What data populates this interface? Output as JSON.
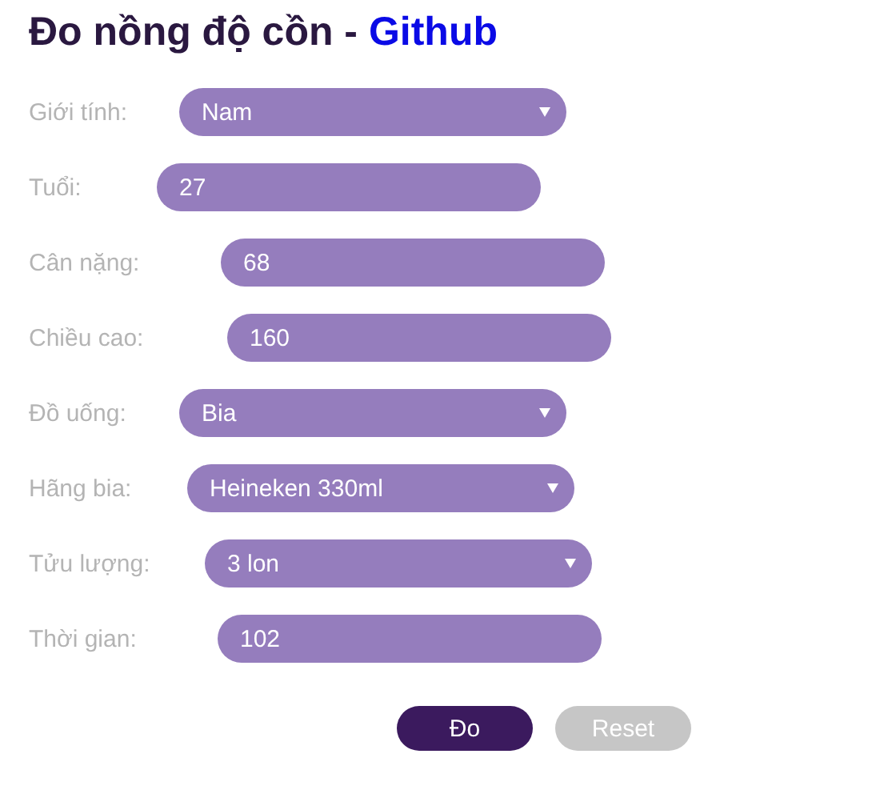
{
  "title": {
    "text": "Đo nồng độ cồn - ",
    "link": "Github"
  },
  "fields": [
    {
      "label": "Giới tính:",
      "kind": "select",
      "value": "Nam"
    },
    {
      "label": "Tuổi:",
      "kind": "input",
      "value": "27"
    },
    {
      "label": "Cân nặng:",
      "kind": "input",
      "value": "68"
    },
    {
      "label": "Chiều cao:",
      "kind": "input",
      "value": "160"
    },
    {
      "label": "Đồ uống:",
      "kind": "select",
      "value": "Bia"
    },
    {
      "label": "Hãng bia:",
      "kind": "select",
      "value": "Heineken 330ml"
    },
    {
      "label": "Tửu lượng:",
      "kind": "select",
      "value": "3 lon"
    },
    {
      "label": "Thời gian:",
      "kind": "input",
      "value": "102"
    }
  ],
  "buttons": [
    {
      "label": "Đo",
      "disabled": false
    },
    {
      "label": "Reset",
      "disabled": true
    }
  ]
}
